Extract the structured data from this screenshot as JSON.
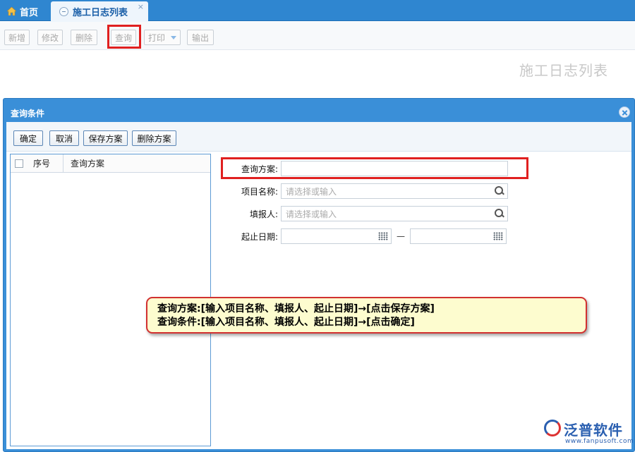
{
  "tabs": {
    "home_label": "首页",
    "active_label": "施工日志列表",
    "close_glyph": "×"
  },
  "toolbar": {
    "add_label": "新增",
    "edit_label": "修改",
    "delete_label": "删除",
    "query_label": "查询",
    "print_label": "打印",
    "export_label": "输出"
  },
  "page": {
    "heading": "施工日志列表"
  },
  "dialog": {
    "title": "查询条件",
    "buttons": {
      "confirm": "确定",
      "cancel": "取消",
      "save_scheme": "保存方案",
      "delete_scheme": "删除方案"
    },
    "list": {
      "col_seq": "序号",
      "col_scheme": "查询方案"
    },
    "form": {
      "scheme_label": "查询方案:",
      "scheme_value": "",
      "project_label": "项目名称:",
      "project_placeholder": "请选择或输入",
      "reporter_label": "填报人:",
      "reporter_placeholder": "请选择或输入",
      "date_label": "起止日期:",
      "date_from": "",
      "date_to": "",
      "date_separator": "—"
    }
  },
  "callout": {
    "line1": "查询方案:[输入项目名称、填报人、起止日期]→[点击保存方案]",
    "line2": "查询条件:[输入项目名称、填报人、起止日期]→[点击确定]"
  },
  "logo": {
    "name": "泛普软件",
    "url": "www.fanpusoft.com"
  },
  "colors": {
    "accent": "#3a8fd8",
    "highlight": "#e02020",
    "callout_bg": "#fdfccf"
  }
}
